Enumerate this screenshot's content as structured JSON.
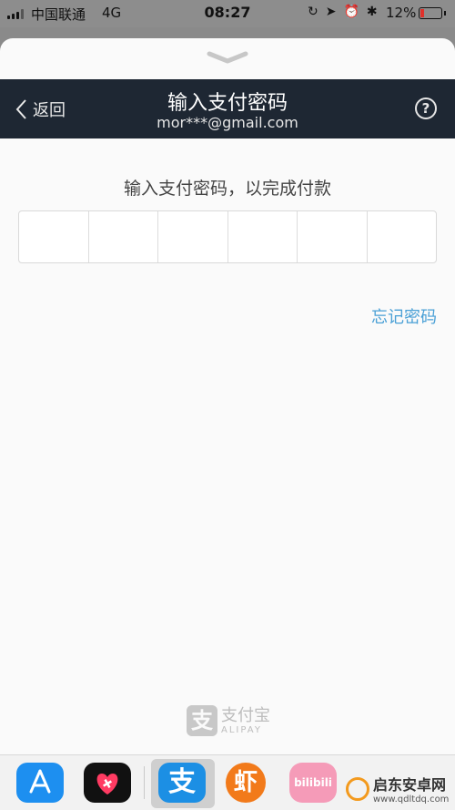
{
  "status_bar": {
    "carrier": "中国联通",
    "network": "4G",
    "time": "08:27",
    "battery_percent": "12%",
    "battery_color": "#e0302a"
  },
  "header": {
    "back_label": "返回",
    "title": "输入支付密码",
    "account": "mor***@gmail.com",
    "help_icon": "question-circle-icon",
    "background": "#1e2733"
  },
  "main": {
    "prompt": "输入支付密码，以完成付款",
    "pin_cells": 6,
    "forgot_label": "忘记密码",
    "link_color": "#4aa0d6"
  },
  "brand": {
    "logo_char": "支",
    "name": "支付宝",
    "name_en": "ALIPAY"
  },
  "dock": {
    "apps": [
      {
        "name": "app-store-icon"
      },
      {
        "name": "health-icon"
      },
      {
        "name": "alipay-icon",
        "glyph": "支"
      },
      {
        "name": "xiami-icon",
        "glyph": "虾"
      },
      {
        "name": "bilibili-icon",
        "glyph": "bilibili"
      }
    ]
  },
  "watermark": {
    "name": "启东安卓网",
    "url": "www.qdltdq.com"
  }
}
